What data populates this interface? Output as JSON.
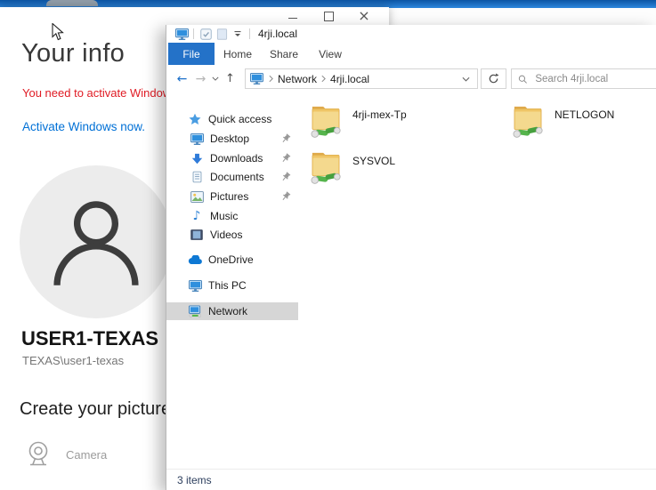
{
  "colors": {
    "top_bar_blue": "#1a6ec0",
    "file_tab_blue": "#2472c8",
    "activation_warning_red": "#e01b24",
    "link_blue": "#0070d6",
    "selection_gray": "#d6d6d6",
    "folder_tan": "#efc566",
    "cable_green": "#55b44c"
  },
  "settings_window": {
    "title_bar": {
      "close_glyph": "×"
    },
    "page_title": "Your info",
    "activation_warning": "You need to activate Windows",
    "activation_link": "Activate Windows now.",
    "user_display_name": "USER1-TEXAS",
    "user_domain_account": "TEXAS\\user1-texas",
    "create_picture_heading": "Create your picture",
    "camera_label": "Camera"
  },
  "explorer_window": {
    "window_title": "4rji.local",
    "ribbon_tabs": [
      {
        "label": "File"
      },
      {
        "label": "Home"
      },
      {
        "label": "Share"
      },
      {
        "label": "View"
      }
    ],
    "toolbar_glyphs": {
      "back": "←",
      "forward": "→",
      "up": "↑"
    },
    "breadcrumbs": [
      "Network",
      "4rji.local"
    ],
    "search_placeholder": "Search 4rji.local",
    "nav_pane": {
      "quick_access_label": "Quick access",
      "quick_access_items": [
        {
          "label": "Desktop",
          "pinned": true
        },
        {
          "label": "Downloads",
          "pinned": true
        },
        {
          "label": "Documents",
          "pinned": true
        },
        {
          "label": "Pictures",
          "pinned": true
        },
        {
          "label": "Music",
          "pinned": false
        },
        {
          "label": "Videos",
          "pinned": false
        }
      ],
      "root_items": [
        {
          "label": "OneDrive"
        },
        {
          "label": "This PC"
        },
        {
          "label": "Network",
          "selected": true
        }
      ],
      "music_note_glyph": "♪"
    },
    "folders": [
      {
        "name": "4rji-mex-Tp"
      },
      {
        "name": "NETLOGON"
      },
      {
        "name": "SYSVOL"
      }
    ],
    "status_bar_text": "3 items"
  }
}
